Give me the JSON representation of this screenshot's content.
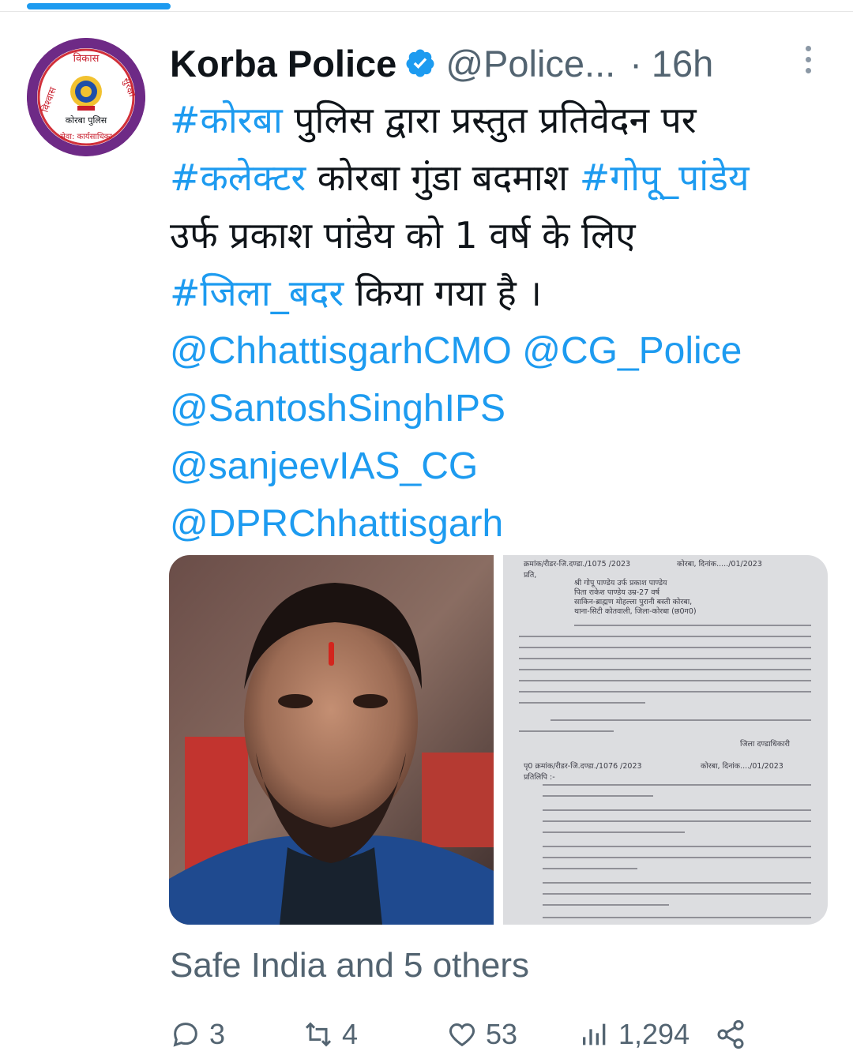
{
  "tweet": {
    "author_name": "Korba Police",
    "handle": "@Police...",
    "separator": "·",
    "time": "16h",
    "avatar_text_top": "विकास",
    "avatar_text_left": "विश्वास",
    "avatar_text_right": "सुरक्षा",
    "avatar_text_center": "कोरबा पुलिस",
    "avatar_text_bottom": "सेवा: कार्यसाधिका",
    "body": {
      "l1_tag": "#कोरबा",
      "l1_rest": " पुलिस द्वारा प्रस्तुत प्रतिवेदन पर",
      "l2_tag1": "#कलेक्टर",
      "l2_mid": " कोरबा गुंडा बदमाश ",
      "l2_tag2": "#गोपू_पांडेय",
      "l3": "उर्फ प्रकाश पांडेय को 1 वर्ष के लिए",
      "l4_tag": "#जिला_बदर",
      "l4_rest": " किया गया है ।",
      "m1": "@ChhattisgarhCMO",
      "m2": "@CG_Police",
      "m3": "@SantoshSinghIPS",
      "m4": "@sanjeevIAS_CG",
      "m5": "@DPRChhattisgarh"
    },
    "document": {
      "ref1": "क्रमांक/रीडर-जि.दण्डा./1075 /2023",
      "city1": "कोरबा, दिनांक...../01/2023",
      "to": "प्रति,",
      "addr1": "श्री गोपू पाण्डेय उर्फ प्रकाश पाण्डेय",
      "addr2": "पिता राकेश पाण्डेय उम्र-27 वर्ष",
      "addr3": "साकिन-ब्राह्मण मोहल्ला पुरानी बस्ती कोरबा,",
      "addr4": "थाना-सिटी कोतवाली, जिला-कोरबा (छ0ग0)",
      "ref2": "पृ0 क्रमांक/रीडर-जि.दण्डा./1076 /2023",
      "city2": "कोरबा, दिनांक..../01/2023",
      "copy": "प्रतिलिपि :-",
      "seal": "जिला दण्डाधिकारी"
    },
    "liked_by": "Safe India and 5 others",
    "stats": {
      "replies": "3",
      "retweets": "4",
      "likes": "53",
      "views": "1,294"
    }
  }
}
